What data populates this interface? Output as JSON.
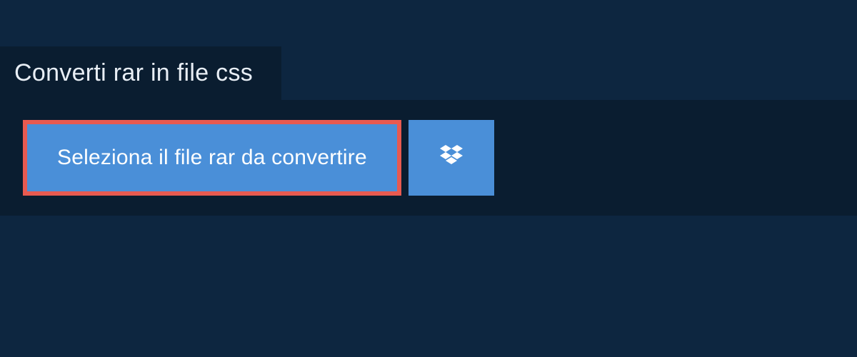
{
  "title": "Converti rar in file css",
  "select_button_label": "Seleziona il file rar da convertire"
}
